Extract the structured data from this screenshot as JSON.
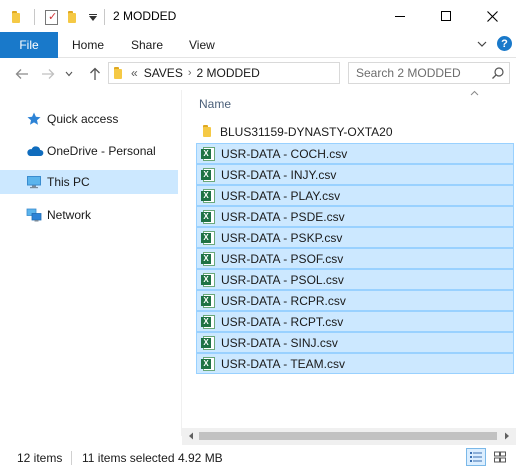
{
  "window": {
    "title": "2 MODDED",
    "minimize_glyph": "—",
    "maximize_glyph": "☐",
    "close_glyph": "✕"
  },
  "ribbon": {
    "file_tab": "File",
    "tabs": [
      "Home",
      "Share",
      "View"
    ],
    "help_glyph": "?",
    "accent_color": "#1979ca"
  },
  "address": {
    "overflow": "«",
    "crumbs": [
      "SAVES",
      "2 MODDED"
    ],
    "separator": "›"
  },
  "search": {
    "placeholder": "Search 2 MODDED"
  },
  "nav_pane": {
    "items": [
      {
        "label": "Quick access",
        "icon": "star-icon",
        "selected": false
      },
      {
        "label": "OneDrive - Personal",
        "icon": "cloud-icon",
        "selected": false
      },
      {
        "label": "This PC",
        "icon": "computer-icon",
        "selected": true
      },
      {
        "label": "Network",
        "icon": "network-icon",
        "selected": false
      }
    ]
  },
  "content": {
    "column_header": "Name",
    "files": [
      {
        "name": "BLUS31159-DYNASTY-OXTA20",
        "type": "folder",
        "selected": false
      },
      {
        "name": "USR-DATA - COCH.csv",
        "type": "csv",
        "selected": true
      },
      {
        "name": "USR-DATA - INJY.csv",
        "type": "csv",
        "selected": true
      },
      {
        "name": "USR-DATA - PLAY.csv",
        "type": "csv",
        "selected": true
      },
      {
        "name": "USR-DATA - PSDE.csv",
        "type": "csv",
        "selected": true
      },
      {
        "name": "USR-DATA - PSKP.csv",
        "type": "csv",
        "selected": true
      },
      {
        "name": "USR-DATA - PSOF.csv",
        "type": "csv",
        "selected": true
      },
      {
        "name": "USR-DATA - PSOL.csv",
        "type": "csv",
        "selected": true
      },
      {
        "name": "USR-DATA - RCPR.csv",
        "type": "csv",
        "selected": true
      },
      {
        "name": "USR-DATA - RCPT.csv",
        "type": "csv",
        "selected": true
      },
      {
        "name": "USR-DATA - SINJ.csv",
        "type": "csv",
        "selected": true
      },
      {
        "name": "USR-DATA - TEAM.csv",
        "type": "csv",
        "selected": true
      }
    ],
    "selection_color": "#cce8ff"
  },
  "status": {
    "item_count": "12 items",
    "selected_text": "11 items selected",
    "selected_size": "4.92 MB"
  }
}
